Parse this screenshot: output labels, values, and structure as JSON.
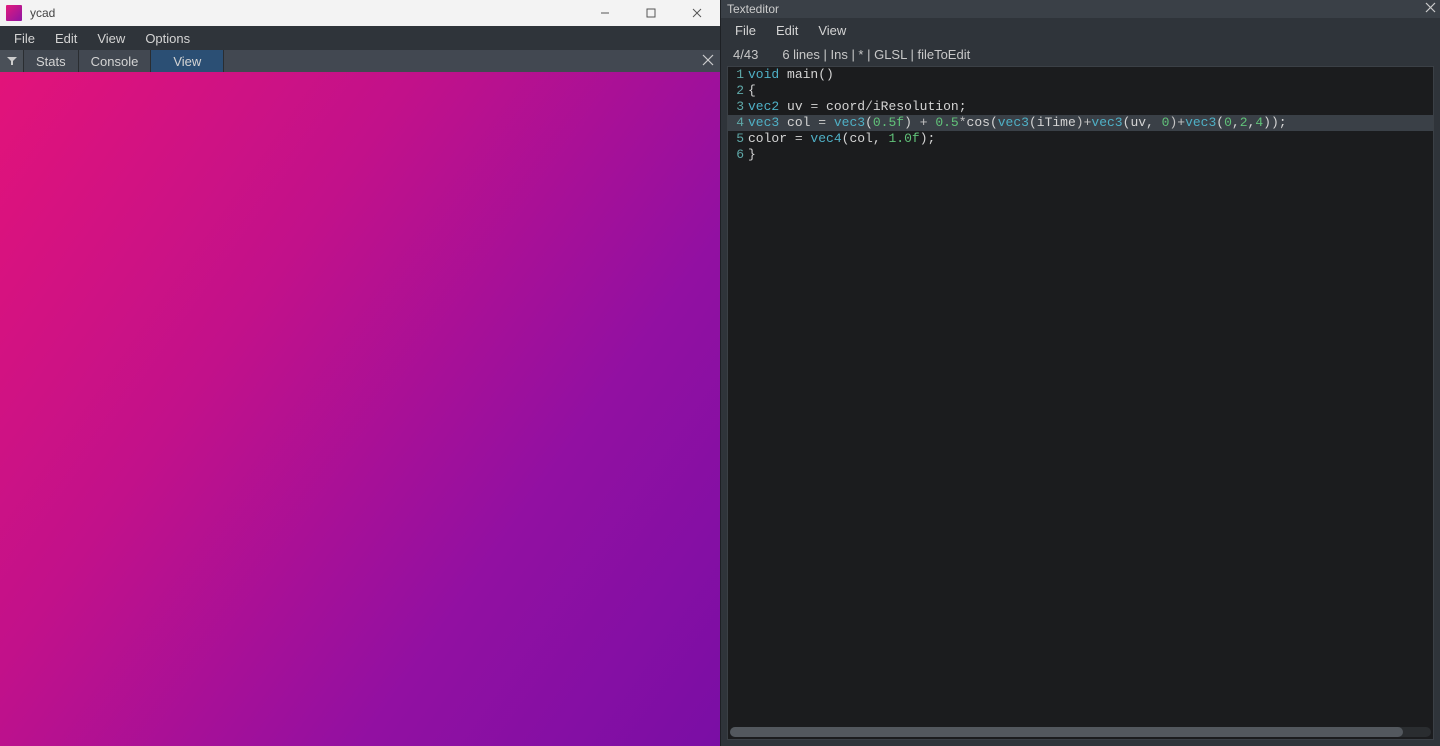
{
  "left": {
    "title": "ycad",
    "menu": [
      "File",
      "Edit",
      "View",
      "Options"
    ],
    "tabs": [
      "Stats",
      "Console",
      "View"
    ],
    "active_tab": "View"
  },
  "right": {
    "title": "Texteditor",
    "menu": [
      "File",
      "Edit",
      "View"
    ],
    "status": {
      "cursor": "4/43",
      "rest": "6 lines  | Ins | * | GLSL | fileToEdit"
    }
  },
  "code": {
    "lines": [
      {
        "n": 1,
        "kw1": "void",
        "rest": " main()",
        "cur": false
      },
      {
        "n": 2,
        "txt": "{",
        "cur": false
      },
      {
        "n": 3,
        "a": "vec2",
        "b": " uv ",
        "c": "=",
        "d": " coord",
        "e": "/",
        "f": "iResolution",
        "g": ";",
        "cur": false
      },
      {
        "n": 4,
        "cur": true,
        "p1": "vec3",
        "p2": " col ",
        "p3": "=",
        "p4": " vec3",
        "p5": "(",
        "p6": "0.5f",
        "p7": ")",
        "p8": " + ",
        "p9": "0.5",
        "p10": "*",
        "p11": "cos",
        "p12": "(",
        "p13": "vec3",
        "p14": "(",
        "p15": "iTime",
        "p16": ")+",
        "p17": "vec3",
        "p18": "(",
        "p19": "uv, ",
        "p20": "0",
        "p21": ")+",
        "p22": "vec3",
        "p23": "(",
        "p24": "0",
        "p25": ",",
        "p26": "2",
        "p27": ",",
        "p28": "4",
        "p29": "));"
      },
      {
        "n": 5,
        "q1": "color ",
        "q2": "=",
        "q3": " vec4",
        "q4": "(",
        "q5": "col, ",
        "q6": "1.0f",
        "q7": ");",
        "cur": false
      },
      {
        "n": 6,
        "txt": "}",
        "cur": false
      }
    ]
  }
}
